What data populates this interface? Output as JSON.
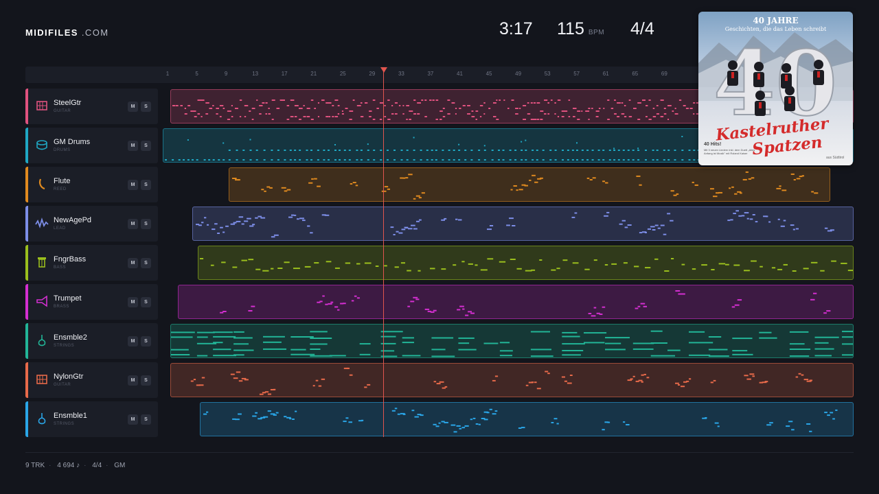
{
  "brand": {
    "name": "MIDIFILES",
    "suffix": ".COM"
  },
  "transport": {
    "time": "3:17",
    "tempo": "115",
    "tempo_unit": "BPM",
    "signature": "4/4"
  },
  "ruler": {
    "ticks": [
      "1",
      "5",
      "9",
      "13",
      "17",
      "21",
      "25",
      "29",
      "33",
      "37",
      "41",
      "45",
      "49",
      "53",
      "57",
      "61",
      "65",
      "69"
    ]
  },
  "playhead_bar": 29,
  "tracks": [
    {
      "name": "SteelGtr",
      "category": "GUITAR",
      "color": "#e0527f",
      "icon": "guitar-icon"
    },
    {
      "name": "GM Drums",
      "category": "DRUMS",
      "color": "#1fa8c4",
      "icon": "drum-icon"
    },
    {
      "name": "Flute",
      "category": "REED",
      "color": "#e08a1f",
      "icon": "flute-icon"
    },
    {
      "name": "NewAgePd",
      "category": "LEAD",
      "color": "#7d8ee8",
      "icon": "wave-icon"
    },
    {
      "name": "FngrBass",
      "category": "BASS",
      "color": "#9bbf1d",
      "icon": "bass-icon"
    },
    {
      "name": "Trumpet",
      "category": "BRASS",
      "color": "#d42fd1",
      "icon": "trumpet-icon"
    },
    {
      "name": "Ensmble2",
      "category": "STRINGS",
      "color": "#22b597",
      "icon": "violin-icon"
    },
    {
      "name": "NylonGtr",
      "category": "GUITAR",
      "color": "#e86a4a",
      "icon": "guitar-icon"
    },
    {
      "name": "Ensmble1",
      "category": "STRINGS",
      "color": "#2aa6e8",
      "icon": "violin-icon"
    }
  ],
  "controls": {
    "mute": "M",
    "solo": "S"
  },
  "album": {
    "line1": "40 JAHRE",
    "line2": "Geschichten, die das Leben schreibt",
    "artist1": "Kastelruther",
    "artist2": "Spatzen",
    "count": "40 Hits!",
    "details": "Mit 3 neuen Liedern inkl. dem Duett „Alles Anfang ist Musik\" mit Roland Kaiser",
    "origin": "aus Südtirol"
  },
  "footer": {
    "tracks": "9 TRK",
    "notes": "4 694 ♪",
    "signature": "4/4",
    "standard": "GM"
  }
}
